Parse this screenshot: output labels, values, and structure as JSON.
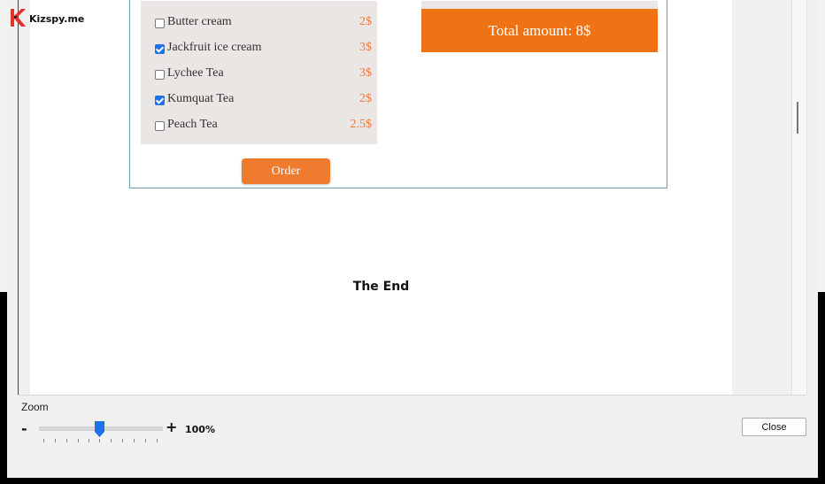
{
  "logo": {
    "text": "Kizspy.me",
    "icon": "k-logo-icon",
    "color": "#e8312a"
  },
  "menu": {
    "items": [
      {
        "name": "Butter cream",
        "price": "2$",
        "checked": false
      },
      {
        "name": "Jackfruit ice cream",
        "price": "3$",
        "checked": true
      },
      {
        "name": "Lychee Tea",
        "price": "3$",
        "checked": false
      },
      {
        "name": "Kumquat Tea",
        "price": "2$",
        "checked": true
      },
      {
        "name": "Peach Tea",
        "price": "2.5$",
        "checked": false
      }
    ],
    "order_label": "Order"
  },
  "total": {
    "label": "Total amount: 8$"
  },
  "content": {
    "end_text": "The End"
  },
  "zoom": {
    "label": "Zoom",
    "minus": "-",
    "plus": "+",
    "value": "100%",
    "level_percent": 100
  },
  "dialog": {
    "close_label": "Close"
  },
  "colors": {
    "accent": "#ef7314",
    "button": "#f07a2e",
    "price": "#ee7a3d",
    "checkbox": "#1a73e8",
    "slider": "#1a73e8"
  }
}
